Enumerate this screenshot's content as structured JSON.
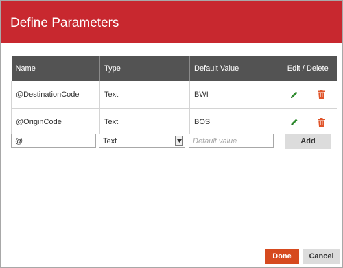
{
  "dialog": {
    "title": "Define Parameters"
  },
  "table": {
    "columns": [
      "Name",
      "Type",
      "Default Value",
      "Edit / Delete"
    ],
    "rows": [
      {
        "name": "@DestinationCode",
        "type": "Text",
        "default_value": "BWI"
      },
      {
        "name": "@OriginCode",
        "type": "Text",
        "default_value": "BOS"
      }
    ]
  },
  "new_param": {
    "name_value": "@",
    "type_selected": "Text",
    "default_placeholder": "Default value",
    "add_label": "Add"
  },
  "footer": {
    "done_label": "Done",
    "cancel_label": "Cancel"
  },
  "colors": {
    "title_bar": "#c8282f",
    "header_bg": "#535353",
    "edit_icon": "#2e8b2e",
    "delete_icon": "#e0542a",
    "done_button": "#d64a1f"
  },
  "icons": {
    "edit": "pencil-icon",
    "delete": "trash-icon",
    "select": "chevron-down-icon"
  }
}
